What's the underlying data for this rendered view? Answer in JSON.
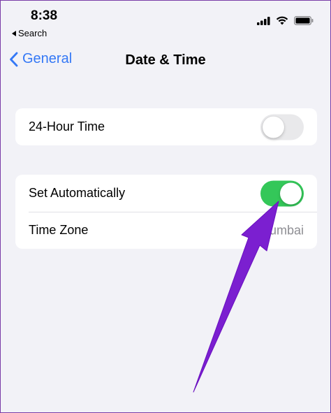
{
  "status_bar": {
    "time": "8:38",
    "back_app_label": "Search",
    "icons": [
      "signal-icon",
      "wifi-icon",
      "battery-icon"
    ]
  },
  "nav": {
    "back_label": "General",
    "title": "Date & Time"
  },
  "groups": [
    {
      "rows": [
        {
          "label": "24-Hour Time",
          "control": "toggle",
          "on": false
        }
      ]
    },
    {
      "rows": [
        {
          "label": "Set Automatically",
          "control": "toggle",
          "on": true
        },
        {
          "label": "Time Zone",
          "value": "Mumbai"
        }
      ]
    }
  ],
  "colors": {
    "accent": "#3478f6",
    "toggle_on": "#34c759",
    "toggle_off": "#e9e9eb",
    "background": "#f2f2f7",
    "annotation_arrow": "#7b1fd0"
  }
}
